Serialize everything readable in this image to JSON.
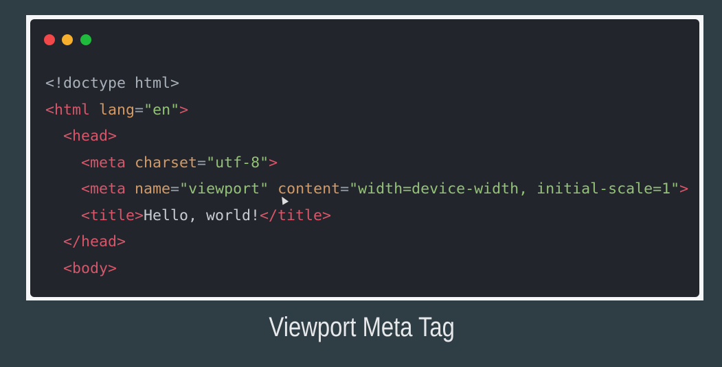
{
  "window": {
    "controls": [
      {
        "name": "close",
        "color": "#f2484a"
      },
      {
        "name": "minimize",
        "color": "#f6b02d"
      },
      {
        "name": "maximize",
        "color": "#1fbb3d"
      }
    ]
  },
  "code": {
    "lines": [
      {
        "indent": 0,
        "tokens": [
          {
            "k": "plain",
            "text": "<!doctype html>"
          }
        ]
      },
      {
        "indent": 0,
        "tokens": [
          {
            "k": "tag",
            "text": "<html"
          },
          {
            "k": "plain",
            "text": " "
          },
          {
            "k": "attr",
            "text": "lang"
          },
          {
            "k": "punct",
            "text": "="
          },
          {
            "k": "str",
            "text": "\"en\""
          },
          {
            "k": "tag",
            "text": ">"
          }
        ]
      },
      {
        "indent": 1,
        "tokens": [
          {
            "k": "tag",
            "text": "<head>"
          }
        ]
      },
      {
        "indent": 2,
        "tokens": [
          {
            "k": "tag",
            "text": "<meta"
          },
          {
            "k": "plain",
            "text": " "
          },
          {
            "k": "attr",
            "text": "charset"
          },
          {
            "k": "punct",
            "text": "="
          },
          {
            "k": "str",
            "text": "\"utf-8\""
          },
          {
            "k": "tag",
            "text": ">"
          }
        ]
      },
      {
        "indent": 2,
        "tokens": [
          {
            "k": "tag",
            "text": "<meta"
          },
          {
            "k": "plain",
            "text": " "
          },
          {
            "k": "attr",
            "text": "name"
          },
          {
            "k": "punct",
            "text": "="
          },
          {
            "k": "str",
            "text": "\"viewport\""
          },
          {
            "k": "plain",
            "text": " "
          },
          {
            "k": "attr",
            "text": "content"
          },
          {
            "k": "punct",
            "text": "="
          },
          {
            "k": "str",
            "text": "\"width=device-width, initial-scale=1\""
          },
          {
            "k": "tag",
            "text": ">"
          }
        ]
      },
      {
        "indent": 2,
        "tokens": [
          {
            "k": "tag",
            "text": "<title>"
          },
          {
            "k": "text",
            "text": "Hello, world!"
          },
          {
            "k": "tag",
            "text": "</title>"
          }
        ]
      },
      {
        "indent": 1,
        "tokens": [
          {
            "k": "tag",
            "text": "</head>"
          }
        ]
      },
      {
        "indent": 1,
        "tokens": [
          {
            "k": "tag",
            "text": "<body>"
          }
        ]
      }
    ]
  },
  "caption": "Viewport Meta Tag"
}
